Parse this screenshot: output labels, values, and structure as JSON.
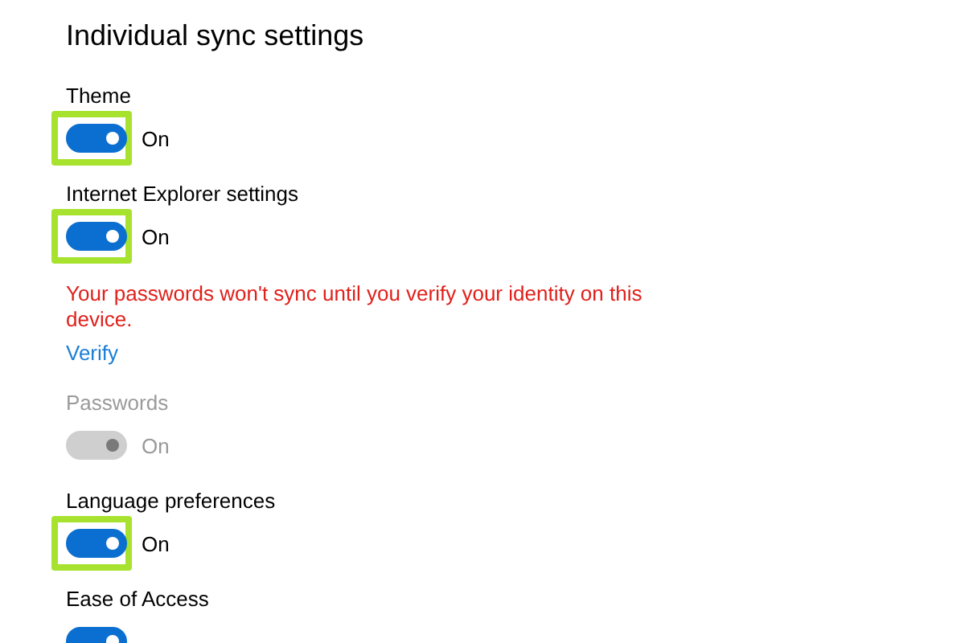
{
  "title": "Individual sync settings",
  "items": [
    {
      "kind": "toggle",
      "label": "Theme",
      "on": true,
      "state_text": "On",
      "disabled": false,
      "highlighted": true
    },
    {
      "kind": "toggle",
      "label": "Internet Explorer settings",
      "on": true,
      "state_text": "On",
      "disabled": false,
      "highlighted": true
    },
    {
      "kind": "warning",
      "text": "Your passwords won't sync until you verify your identity on this device."
    },
    {
      "kind": "link",
      "text": "Verify"
    },
    {
      "kind": "toggle",
      "label": "Passwords",
      "on": true,
      "state_text": "On",
      "disabled": true,
      "highlighted": false
    },
    {
      "kind": "toggle",
      "label": "Language preferences",
      "on": true,
      "state_text": "On",
      "disabled": false,
      "highlighted": true
    },
    {
      "kind": "toggle",
      "label": "Ease of Access",
      "on": true,
      "disabled": false,
      "highlighted": false
    }
  ]
}
